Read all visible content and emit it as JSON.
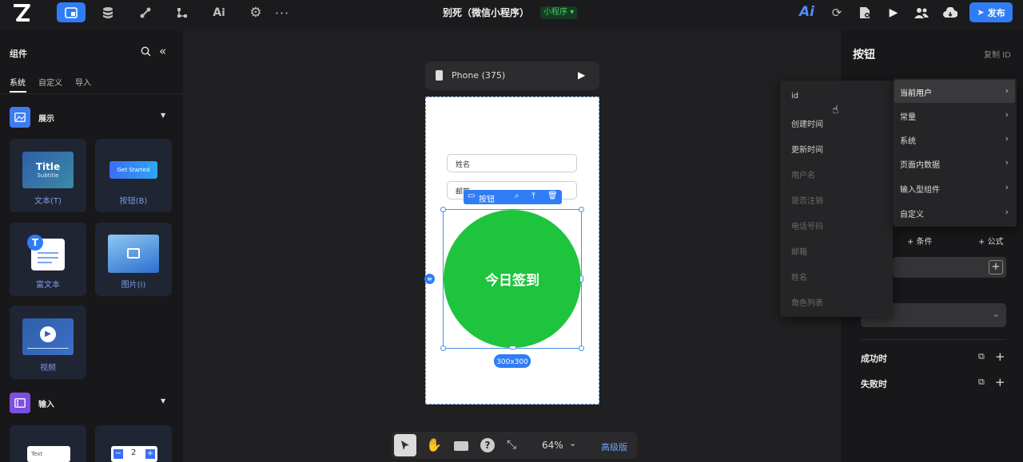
{
  "app": {
    "title": "别死（微信小程序）",
    "badge": "小程序 ▾",
    "publish": "发布",
    "accent": "#2f7df6"
  },
  "sidebar": {
    "title": "组件",
    "tabs": [
      "系统",
      "自定义",
      "导入"
    ],
    "sections": [
      {
        "label": "展示"
      },
      {
        "label": "输入"
      }
    ],
    "cards": [
      {
        "label": "文本(T)",
        "thumb_title": "Title",
        "thumb_sub": "Subtitle"
      },
      {
        "label": "按钮(B)",
        "thumb_btn": "Get Started"
      },
      {
        "label": "富文本"
      },
      {
        "label": "图片(I)"
      },
      {
        "label": "视频"
      }
    ],
    "input_thumbs": [
      "Text",
      "2"
    ]
  },
  "canvas": {
    "device": "Phone (375)",
    "fields": [
      "姓名",
      "邮箱"
    ],
    "toolbar_label": "按钮",
    "circle_text": "今日签到",
    "size_badge": "300x300",
    "circle_color": "#1ec43c",
    "zoom": "64%",
    "advanced": "高级版"
  },
  "panel": {
    "title": "按钮",
    "copy_id": "复制 ID",
    "add_condition": "+ 条件",
    "add_formula": "+ 公式",
    "success": "成功时",
    "fail": "失败时"
  },
  "menu_left": {
    "items": [
      {
        "label": "id",
        "enabled": true
      },
      {
        "label": "创建时间",
        "enabled": true
      },
      {
        "label": "更新时间",
        "enabled": true
      },
      {
        "label": "用户名",
        "enabled": false
      },
      {
        "label": "是否注销",
        "enabled": false
      },
      {
        "label": "电话号码",
        "enabled": false
      },
      {
        "label": "邮箱",
        "enabled": false
      },
      {
        "label": "姓名",
        "enabled": false
      },
      {
        "label": "角色列表",
        "enabled": false
      }
    ]
  },
  "menu_right": {
    "items": [
      {
        "label": "当前用户",
        "active": true
      },
      {
        "label": "常量"
      },
      {
        "label": "系统"
      },
      {
        "label": "页面内数据"
      },
      {
        "label": "输入型组件"
      },
      {
        "label": "自定义"
      }
    ]
  }
}
